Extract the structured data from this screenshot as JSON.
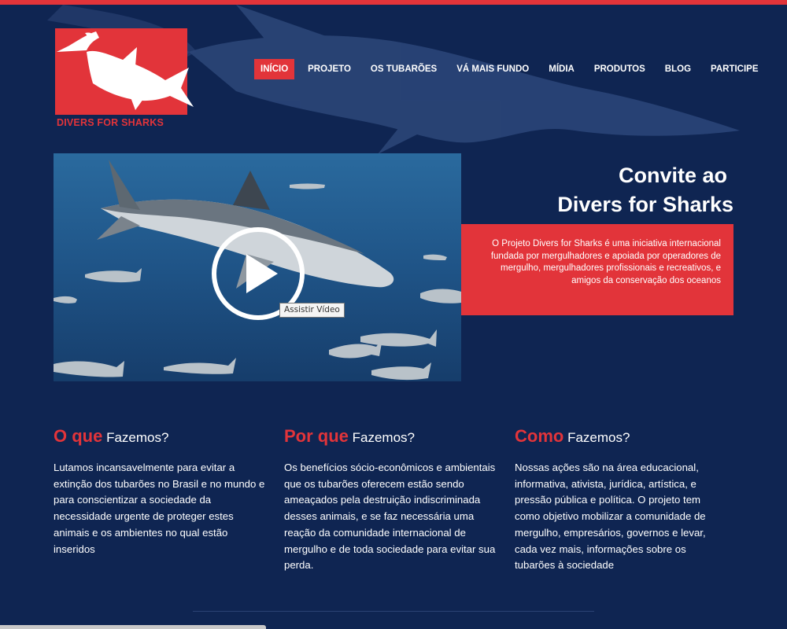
{
  "logo": {
    "text": "DIVERS FOR SHARKS"
  },
  "nav": {
    "items": [
      {
        "label": "INÍCIO",
        "active": true
      },
      {
        "label": "PROJETO",
        "active": false
      },
      {
        "label": "OS TUBARÕES",
        "active": false
      },
      {
        "label": "VÁ MAIS FUNDO",
        "active": false
      },
      {
        "label": "MÍDIA",
        "active": false
      },
      {
        "label": "PRODUTOS",
        "active": false
      },
      {
        "label": "BLOG",
        "active": false
      },
      {
        "label": "PARTICIPE",
        "active": false
      }
    ]
  },
  "video": {
    "tooltip": "Assistir Vídeo"
  },
  "invite": {
    "title_line1": "Convite ao",
    "title_line2": "Divers for Sharks",
    "text": "O Projeto Divers for Sharks é uma iniciativa internacional fundada por mergulhadores e apoiada por operadores de mergulho, mergulhadores profissionais e recreativos, e amigos da conservação dos oceanos"
  },
  "columns": [
    {
      "highlight": "O que",
      "rest": "Fazemos?",
      "text": "Lutamos incansavelmente para evitar a extinção dos tubarões no Brasil e no mundo e para conscientizar a sociedade da necessidade urgente de proteger estes animais e os ambientes no qual estão inseridos"
    },
    {
      "highlight": "Por que",
      "rest": "Fazemos?",
      "text": "Os benefícios sócio-econômicos e ambientais que os tubarões oferecem estão sendo ameaçados pela destruição indiscriminada desses animais, e se faz necessária uma reação da comunidade internacional de mergulho e de toda sociedade para evitar sua perda."
    },
    {
      "highlight": "Como",
      "rest": "Fazemos?",
      "text": "Nossas ações são na área educacional, informativa, ativista, jurídica, artística, e pressão pública e política. O projeto tem como objetivo mobilizar a comunidade de mergulho, empresários, governos e levar, cada vez mais, informações sobre os tubarões à sociedade"
    }
  ],
  "colors": {
    "background": "#0f2552",
    "accent": "#e2343a",
    "text": "#ffffff"
  },
  "icons": {
    "logo": "hammerhead-shark-icon",
    "play": "play-icon"
  }
}
